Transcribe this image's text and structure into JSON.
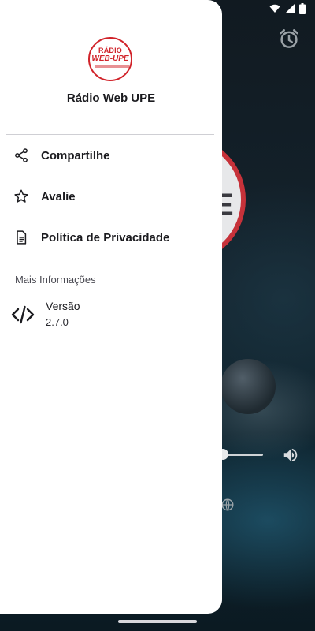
{
  "app": {
    "title": "Rádio Web UPE",
    "logo_line1": "RÁDIO",
    "logo_line2": "WEB-UPE"
  },
  "drawer": {
    "items": [
      {
        "label": "Compartilhe",
        "icon": "share-icon"
      },
      {
        "label": "Avalie",
        "icon": "star-icon"
      },
      {
        "label": "Política de Privacidade",
        "icon": "document-icon"
      }
    ],
    "section_title": "Mais Informações",
    "info": {
      "label": "Versão",
      "value": "2.7.0",
      "icon": "code-icon"
    }
  },
  "colors": {
    "accent": "#d1232a",
    "drawer_bg": "#ffffff",
    "text": "#1b1b1f"
  }
}
